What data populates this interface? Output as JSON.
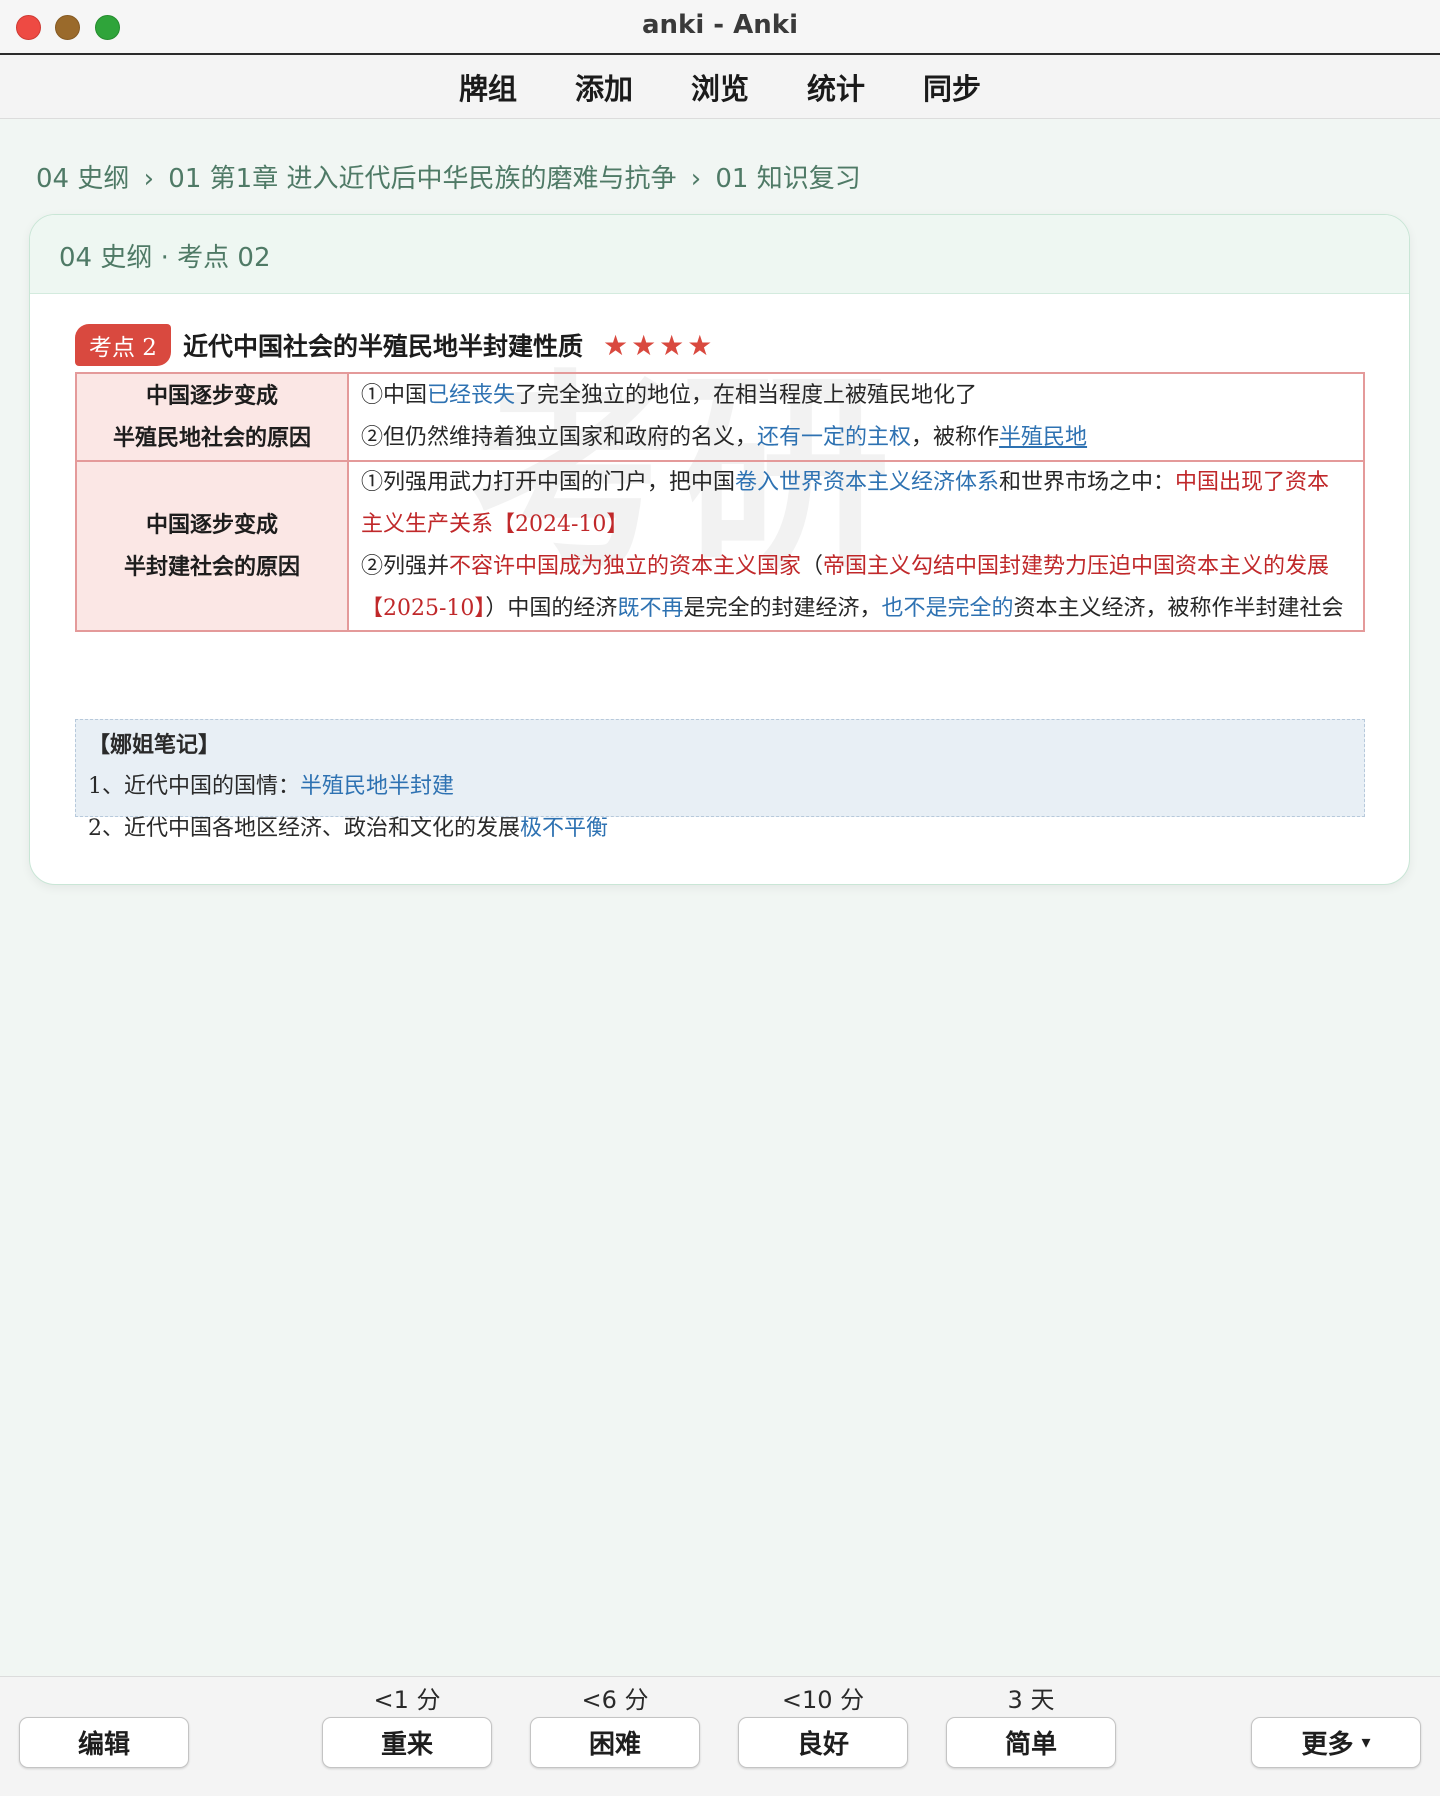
{
  "window": {
    "title": "anki - Anki"
  },
  "nav": {
    "items": [
      "牌组",
      "添加",
      "浏览",
      "统计",
      "同步"
    ]
  },
  "breadcrumb": {
    "parts": [
      "04 史纲",
      "01 第1章 进入近代后中华民族的磨难与抗争",
      "01 知识复习"
    ],
    "separator": "›"
  },
  "card": {
    "header": "04 史纲 · 考点 02",
    "watermark": "考研",
    "badge": "考点 2",
    "title": "近代中国社会的半殖民地半封建性质",
    "stars": "★★★★",
    "row1": {
      "label_line1": "中国逐步变成",
      "label_line2": "半殖民地社会的原因",
      "l1_a": "①中国",
      "l1_b": "已经丧失",
      "l1_c": "了完全独立的地位，在相当程度上被殖民地化了",
      "l2_a": "②但仍然维持着独立国家和政府的名义，",
      "l2_b": "还有一定的主权",
      "l2_c": "，被称作",
      "l2_d": "半殖民地"
    },
    "row2": {
      "label_line1": "中国逐步变成",
      "label_line2": "半封建社会的原因",
      "p1_a": "①列强用武力打开中国的门户，把中国",
      "p1_b": "卷入世界资本主义经济体系",
      "p1_c": "和世界市场之中：",
      "p1_d": "中国出现了资本主义生产关系【2024-10】",
      "p2_a": "②列强并",
      "p2_b": "不容许中国成为独立的资本主义国家",
      "p2_c": "（",
      "p2_d": "帝国主义勾结中国封建势力压迫中国资本主义的发展【2025-10】",
      "p2_e": "）中国的经济",
      "p2_f": "既不再",
      "p2_g": "是完全的封建经济，",
      "p2_h": "也不是完全的",
      "p2_i": "资本主义经济，被称作半封建社会"
    },
    "note": {
      "title": "【娜姐笔记】",
      "line1_a": "1、近代中国的国情：",
      "line1_b": "半殖民地半封建",
      "line2_a": "2、近代中国各地区经济、政治和文化的发展",
      "line2_b": "极不平衡"
    }
  },
  "bottom": {
    "edit": "编辑",
    "answers": [
      {
        "label": "重来",
        "interval": "<1 分"
      },
      {
        "label": "困难",
        "interval": "<6 分"
      },
      {
        "label": "良好",
        "interval": "<10 分"
      },
      {
        "label": "简单",
        "interval": "3 天"
      }
    ],
    "more": "更多",
    "more_caret": "▾"
  },
  "colors": {
    "accent_green": "#4f7a66",
    "badge_red": "#d9493f",
    "highlight_blue": "#2e72b2",
    "highlight_red": "#c0282a"
  }
}
